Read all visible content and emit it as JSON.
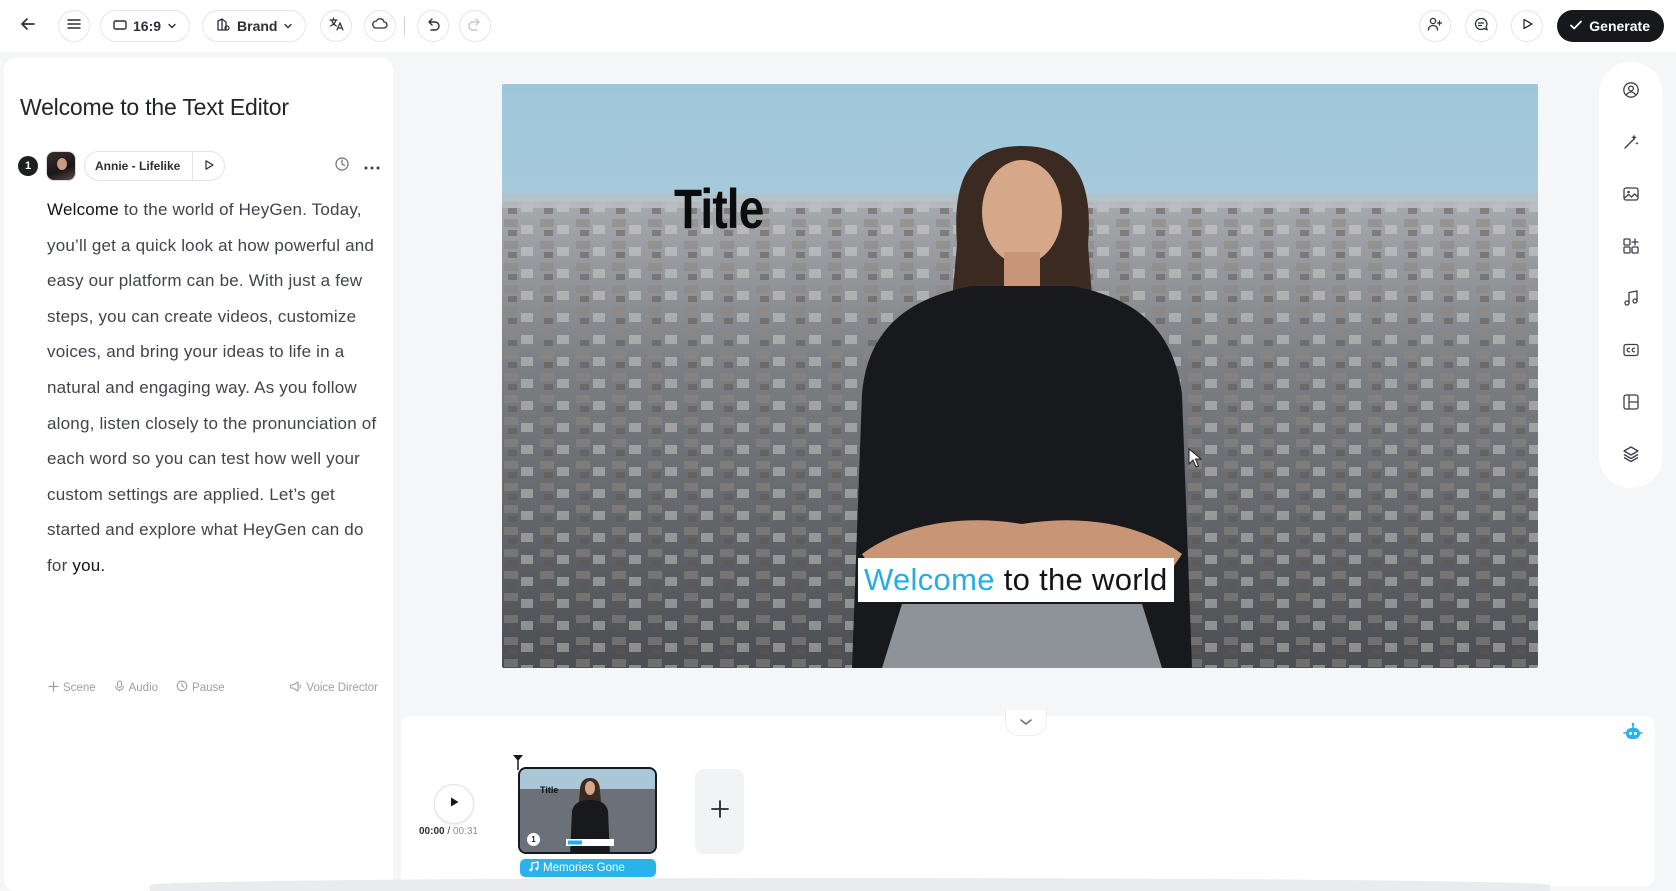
{
  "toolbar": {
    "aspect_label": "16:9",
    "brand_label": "Brand",
    "generate_label": "Generate"
  },
  "editor": {
    "title": "Welcome to the Text Editor",
    "scene_number": "1",
    "voice_name": "Annie - Lifelike",
    "script_first_word": "Welcome",
    "script_body": " to the world of HeyGen. Today, you’ll get a quick look at how powerful and easy our platform can be. With just a few steps, you can create videos, customize voices, and bring your ideas to life in a natural and engaging way. As you follow along, listen closely to the pronunciation of each word so you can test how well your custom settings are applied. Let’s get started and explore what HeyGen can do for ",
    "script_last_word": "you.",
    "tools": {
      "scene": "Scene",
      "audio": "Audio",
      "pause": "Pause",
      "voice_director": "Voice Director"
    }
  },
  "canvas": {
    "title_text": "Title",
    "caption_highlight": "Welcome",
    "caption_rest": "to the world"
  },
  "right_tools": [
    "avatar-icon",
    "magic-sparkle-icon",
    "image-icon",
    "elements-icon",
    "music-icon",
    "captions-icon",
    "layout-icon",
    "layers-icon"
  ],
  "timeline": {
    "current_time": "00:00",
    "separator": " / ",
    "total_time": "00:31",
    "clip_number": "1",
    "clip_title": "Title",
    "music_label": "Memories Gone"
  },
  "colors": {
    "accent": "#29b3ea",
    "caption_highlight": "#27aee0",
    "generate_bg": "#16181c"
  }
}
